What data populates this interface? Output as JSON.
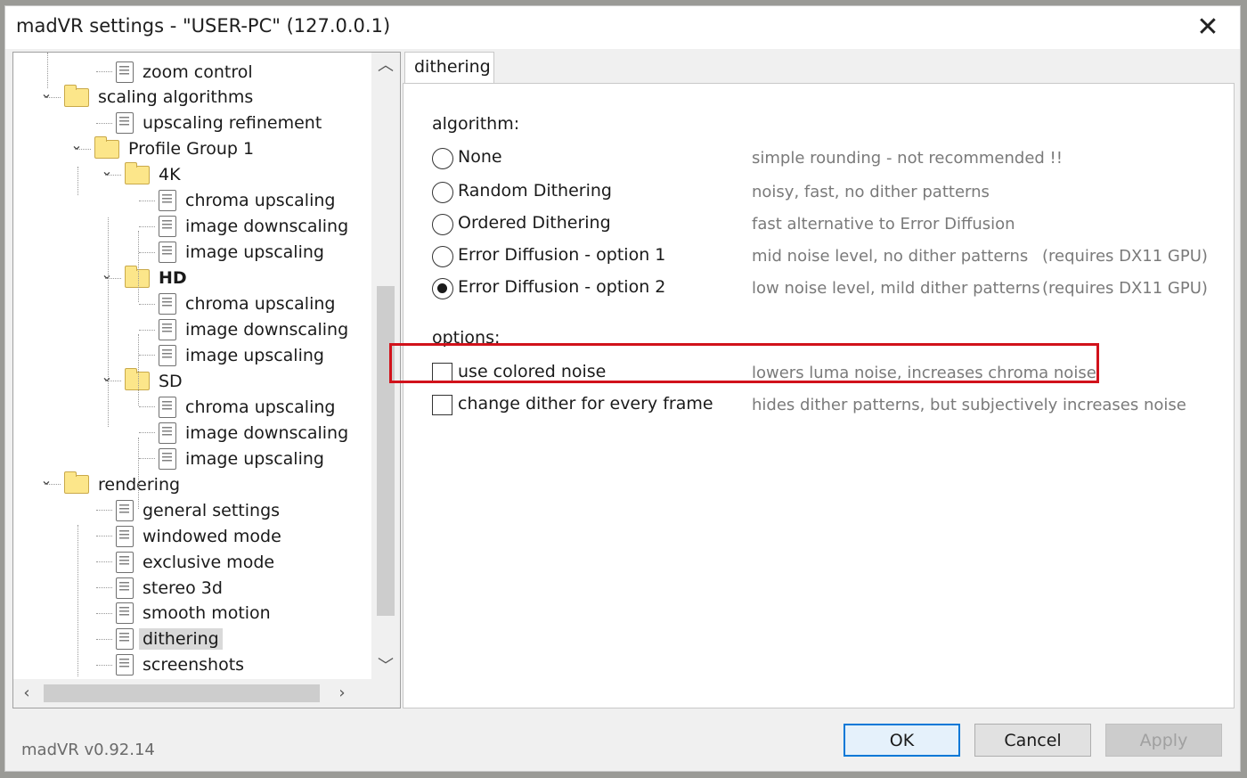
{
  "window": {
    "title": "madVR settings - \"USER-PC\" (127.0.0.1)",
    "close_label": "✕"
  },
  "tree": {
    "items": [
      {
        "label": "zoom control",
        "type": "doc"
      },
      {
        "label": "scaling algorithms",
        "type": "folder",
        "expanded": true
      },
      {
        "label": "upscaling refinement",
        "type": "doc"
      },
      {
        "label": "Profile Group 1",
        "type": "folder",
        "expanded": true
      },
      {
        "label": "4K",
        "type": "folder",
        "expanded": true
      },
      {
        "label": "chroma upscaling",
        "type": "doc"
      },
      {
        "label": "image downscaling",
        "type": "doc"
      },
      {
        "label": "image upscaling",
        "type": "doc"
      },
      {
        "label": "HD",
        "type": "folder",
        "expanded": true,
        "bold": true
      },
      {
        "label": "chroma upscaling",
        "type": "doc"
      },
      {
        "label": "image downscaling",
        "type": "doc"
      },
      {
        "label": "image upscaling",
        "type": "doc"
      },
      {
        "label": "SD",
        "type": "folder",
        "expanded": true
      },
      {
        "label": "chroma upscaling",
        "type": "doc"
      },
      {
        "label": "image downscaling",
        "type": "doc"
      },
      {
        "label": "image upscaling",
        "type": "doc"
      },
      {
        "label": "rendering",
        "type": "folder",
        "expanded": true
      },
      {
        "label": "general settings",
        "type": "doc"
      },
      {
        "label": "windowed mode",
        "type": "doc"
      },
      {
        "label": "exclusive mode",
        "type": "doc"
      },
      {
        "label": "stereo 3d",
        "type": "doc"
      },
      {
        "label": "smooth motion",
        "type": "doc"
      },
      {
        "label": "dithering",
        "type": "doc",
        "selected": true
      },
      {
        "label": "screenshots",
        "type": "doc"
      }
    ]
  },
  "tab": {
    "label": "dithering"
  },
  "algorithm": {
    "section_label": "algorithm:",
    "options": [
      {
        "label": "None",
        "desc": "simple rounding - not recommended !!",
        "req": "",
        "checked": false
      },
      {
        "label": "Random Dithering",
        "desc": "noisy, fast, no dither patterns",
        "req": "",
        "checked": false
      },
      {
        "label": "Ordered Dithering",
        "desc": "fast alternative to Error Diffusion",
        "req": "",
        "checked": false
      },
      {
        "label": "Error Diffusion - option 1",
        "desc": "mid noise level, no dither patterns",
        "req": "(requires DX11 GPU)",
        "checked": false
      },
      {
        "label": "Error Diffusion - option 2",
        "desc": "low noise level, mild dither patterns",
        "req": "(requires DX11 GPU)",
        "checked": true
      }
    ]
  },
  "options": {
    "section_label": "options:",
    "items": [
      {
        "label": "use colored noise",
        "desc": "lowers luma noise, increases chroma noise",
        "checked": false
      },
      {
        "label": "change dither for every frame",
        "desc": "hides dither patterns, but subjectively increases noise",
        "checked": false
      }
    ]
  },
  "footer": {
    "version": "madVR v0.92.14",
    "ok_label": "OK",
    "cancel_label": "Cancel",
    "apply_label": "Apply"
  },
  "colors": {
    "highlight": "#d1121b",
    "default_button_border": "#0078d7"
  }
}
